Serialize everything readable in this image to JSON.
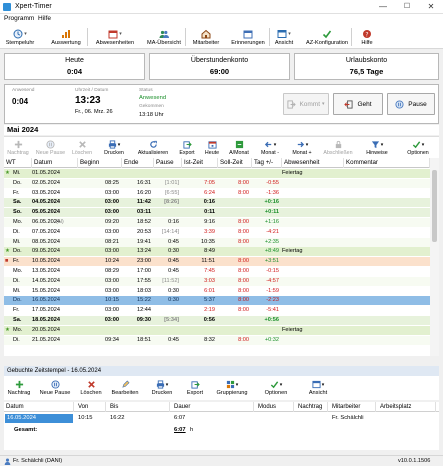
{
  "window": {
    "title": "Xpert-Timer",
    "minimize": "—",
    "maximize": "☐",
    "close": "✕"
  },
  "menu": {
    "items": [
      "Programm",
      "Hilfe"
    ]
  },
  "toolbar": {
    "items": [
      {
        "label": "Stempeluhr",
        "icon": "clock-icon",
        "color": "#2b6cb0",
        "dropdown": true
      },
      {
        "label": "Auswertung",
        "icon": "chart-icon",
        "color": "#d97706"
      },
      {
        "label": "Abwesenheiten",
        "icon": "calendar-icon",
        "color": "#c0392b",
        "dropdown": true
      },
      {
        "label": "MA-Übersicht",
        "icon": "people-icon",
        "color": "#2e8b57"
      },
      {
        "label": "Mitarbeiter",
        "icon": "house-icon",
        "color": "#8b4513"
      },
      {
        "label": "Erinnerungen",
        "icon": "calendar-icon",
        "color": "#3f6fb5"
      },
      {
        "label": "Ansicht",
        "icon": "window-icon",
        "color": "#2b6cb0",
        "dropdown": true
      },
      {
        "label": "AZ-Konfiguration",
        "icon": "check-icon",
        "color": "#2e9a3c"
      },
      {
        "label": "Hilfe",
        "icon": "help-icon",
        "color": "#c0392b"
      }
    ]
  },
  "summary": {
    "heute": {
      "label": "Heute",
      "value": "0:04"
    },
    "ueberstunden": {
      "label": "Überstundenkonto",
      "value": "69:00"
    },
    "urlaub": {
      "label": "Urlaubskonto",
      "value": "76,5 Tage"
    }
  },
  "status": {
    "anwesend_label": "Anwesend",
    "anwesend_value": "0:04",
    "uhrzeit_label": "Uhrzeit / Datum",
    "time": "13:23",
    "date": "Fr., 06. Mrz. 26",
    "status_label": "Status",
    "status_value": "Anwesend",
    "seit_label": "Gekommen",
    "seit_value": "13:18 Uhr",
    "btn_kommt": "Kommt",
    "btn_geht": "Geht",
    "btn_pause": "Pause"
  },
  "month": "Mai 2024",
  "subtoolbar": [
    {
      "label": "Nachtrag",
      "icon": "plus-icon",
      "disabled": true
    },
    {
      "label": "Neue Pause",
      "icon": "pause-icon",
      "disabled": true
    },
    {
      "label": "Löschen",
      "icon": "delete-icon",
      "disabled": true
    },
    {
      "label": "Drucken",
      "icon": "printer-icon",
      "dropdown": true
    },
    {
      "label": "Aktualisieren",
      "icon": "refresh-icon"
    },
    {
      "label": "Export",
      "icon": "export-icon"
    },
    {
      "label": "Heute",
      "icon": "today-icon"
    },
    {
      "label": "A/Monat",
      "icon": "month-icon"
    },
    {
      "label": "Monat -",
      "icon": "left-arrow-icon",
      "dropdown": true
    },
    {
      "label": "Monat +",
      "icon": "right-arrow-icon",
      "dropdown": true
    },
    {
      "label": "Abschließen",
      "icon": "lock-icon",
      "disabled": true
    },
    {
      "label": "Hinweise",
      "icon": "filter-icon",
      "dropdown": true
    },
    {
      "label": "Optionen",
      "icon": "check-icon",
      "dropdown": true
    }
  ],
  "table": {
    "columns": [
      "WT",
      "Datum",
      "Beginn",
      "Ende",
      "Pause",
      "Ist-Zeit",
      "Soll-Zeit",
      "Tag +/-",
      "Abwesenheit",
      "Kommentar"
    ],
    "rows": [
      {
        "wt": "Mi.",
        "d": "01.05.2024",
        "b": "",
        "e": "",
        "p": "",
        "ist": "",
        "soll": "",
        "tag": "",
        "abw": "Feiertag",
        "kind": "holiday",
        "mark": "star"
      },
      {
        "wt": "Do.",
        "d": "02.05.2024",
        "b": "08:25",
        "e": "16:31",
        "p": "[1:01]",
        "ist": "7:05",
        "soll": "8:00",
        "tag": "-0:55",
        "abw": "",
        "kind": "normal"
      },
      {
        "wt": "Fr.",
        "d": "03.05.2024",
        "b": "03:00",
        "e": "16:20",
        "p": "[6:55]",
        "ist": "6:24",
        "soll": "8:00",
        "tag": "-1:36",
        "abw": "",
        "kind": "normal"
      },
      {
        "wt": "Sa.",
        "d": "04.05.2024",
        "b": "03:00",
        "e": "11:42",
        "p": "[8:26]",
        "ist": "0:16",
        "soll": "",
        "tag": "+0:16",
        "abw": "",
        "kind": "weekend"
      },
      {
        "wt": "So.",
        "d": "05.05.2024",
        "b": "03:00",
        "e": "03:11",
        "p": "",
        "ist": "0:11",
        "soll": "",
        "tag": "+0:11",
        "abw": "",
        "kind": "weekend"
      },
      {
        "wt": "Mo.",
        "d": "06.05.2024",
        "b": "09:20",
        "e": "18:52",
        "p": "0:16",
        "ist": "9:16",
        "soll": "8:00",
        "tag": "+1:16",
        "abw": "",
        "kind": "normal",
        "note": "(N)"
      },
      {
        "wt": "Di.",
        "d": "07.05.2024",
        "b": "03:00",
        "e": "20:53",
        "p": "[14:14]",
        "ist": "3:39",
        "soll": "8:00",
        "tag": "-4:21",
        "abw": "",
        "kind": "normal"
      },
      {
        "wt": "Mi.",
        "d": "08.05.2024",
        "b": "08:21",
        "e": "19:41",
        "p": "0:45",
        "ist": "10:35",
        "soll": "8:00",
        "tag": "+2:35",
        "abw": "",
        "kind": "normal"
      },
      {
        "wt": "Do.",
        "d": "09.05.2024",
        "b": "03:00",
        "e": "13:24",
        "p": "0:30",
        "ist": "8:49",
        "soll": "",
        "tag": "+8:49",
        "abw": "Feiertag",
        "kind": "holiday",
        "mark": "star"
      },
      {
        "wt": "Fr.",
        "d": "10.05.2024",
        "b": "10:24",
        "e": "23:00",
        "p": "0:45",
        "ist": "11:51",
        "soll": "8:00",
        "tag": "+3:51",
        "abw": "",
        "kind": "warning",
        "mark": "flag"
      },
      {
        "wt": "Mo.",
        "d": "13.05.2024",
        "b": "08:29",
        "e": "17:00",
        "p": "0:45",
        "ist": "7:45",
        "soll": "8:00",
        "tag": "-0:15",
        "abw": "",
        "kind": "normal"
      },
      {
        "wt": "Di.",
        "d": "14.05.2024",
        "b": "03:00",
        "e": "17:55",
        "p": "[11:52]",
        "ist": "3:03",
        "soll": "8:00",
        "tag": "-4:57",
        "abw": "",
        "kind": "normal"
      },
      {
        "wt": "Mi.",
        "d": "15.05.2024",
        "b": "03:00",
        "e": "18:03",
        "p": "0:30",
        "ist": "6:01",
        "soll": "8:00",
        "tag": "-1:59",
        "abw": "",
        "kind": "normal"
      },
      {
        "wt": "Do.",
        "d": "16.05.2024",
        "b": "10:15",
        "e": "15:22",
        "p": "0:30",
        "ist": "5:37",
        "soll": "8:00",
        "tag": "-2:23",
        "abw": "",
        "kind": "selected"
      },
      {
        "wt": "Fr.",
        "d": "17.05.2024",
        "b": "03:00",
        "e": "12:44",
        "p": "",
        "ist": "2:19",
        "soll": "8:00",
        "tag": "-5:41",
        "abw": "",
        "kind": "normal"
      },
      {
        "wt": "Sa.",
        "d": "18.05.2024",
        "b": "03:00",
        "e": "09:30",
        "p": "[5:34]",
        "ist": "0:56",
        "soll": "",
        "tag": "+0:56",
        "abw": "",
        "kind": "weekend"
      },
      {
        "wt": "Mo.",
        "d": "20.05.2024",
        "b": "",
        "e": "",
        "p": "",
        "ist": "",
        "soll": "",
        "tag": "",
        "abw": "Feiertag",
        "kind": "holiday",
        "mark": "star"
      },
      {
        "wt": "Di.",
        "d": "21.05.2024",
        "b": "09:34",
        "e": "18:51",
        "p": "0:45",
        "ist": "8:32",
        "soll": "8:00",
        "tag": "+0:32",
        "abw": "",
        "kind": "normal"
      }
    ]
  },
  "lower": {
    "title": "Gebuchte Zeitstempel - 16.05.2024",
    "toolbar": [
      {
        "label": "Nachtrag",
        "icon": "plus-icon"
      },
      {
        "label": "Neue Pause",
        "icon": "pause-icon"
      },
      {
        "label": "Löschen",
        "icon": "delete-icon"
      },
      {
        "label": "Bearbeiten",
        "icon": "edit-icon"
      },
      {
        "label": "Drucken",
        "icon": "printer-icon",
        "dropdown": true
      },
      {
        "label": "Export",
        "icon": "export-icon"
      },
      {
        "label": "Gruppierung",
        "icon": "group-icon",
        "dropdown": true
      },
      {
        "label": "Optionen",
        "icon": "check-icon",
        "dropdown": true
      },
      {
        "label": "Ansicht",
        "icon": "window-icon",
        "dropdown": true
      }
    ],
    "columns": [
      "Datum",
      "Von",
      "Bis",
      "Dauer",
      "Modus",
      "Nachtrag",
      "Mitarbeiter",
      "Arbeitsplatz"
    ],
    "rows": [
      {
        "datum": "16.05.2024",
        "von": "10:15",
        "bis": "16:22",
        "dauer": "6:07",
        "modus": "",
        "nachtrag": "",
        "mitarbeiter": "Fr. Schälchli",
        "arbeitsplatz": ""
      }
    ],
    "total_label": "Gesamt:",
    "total_value": "6:07",
    "total_unit": "h"
  },
  "statusbar": {
    "user": "Fr. Schälchli (DANI)",
    "version": "v10.0.1.1506"
  }
}
